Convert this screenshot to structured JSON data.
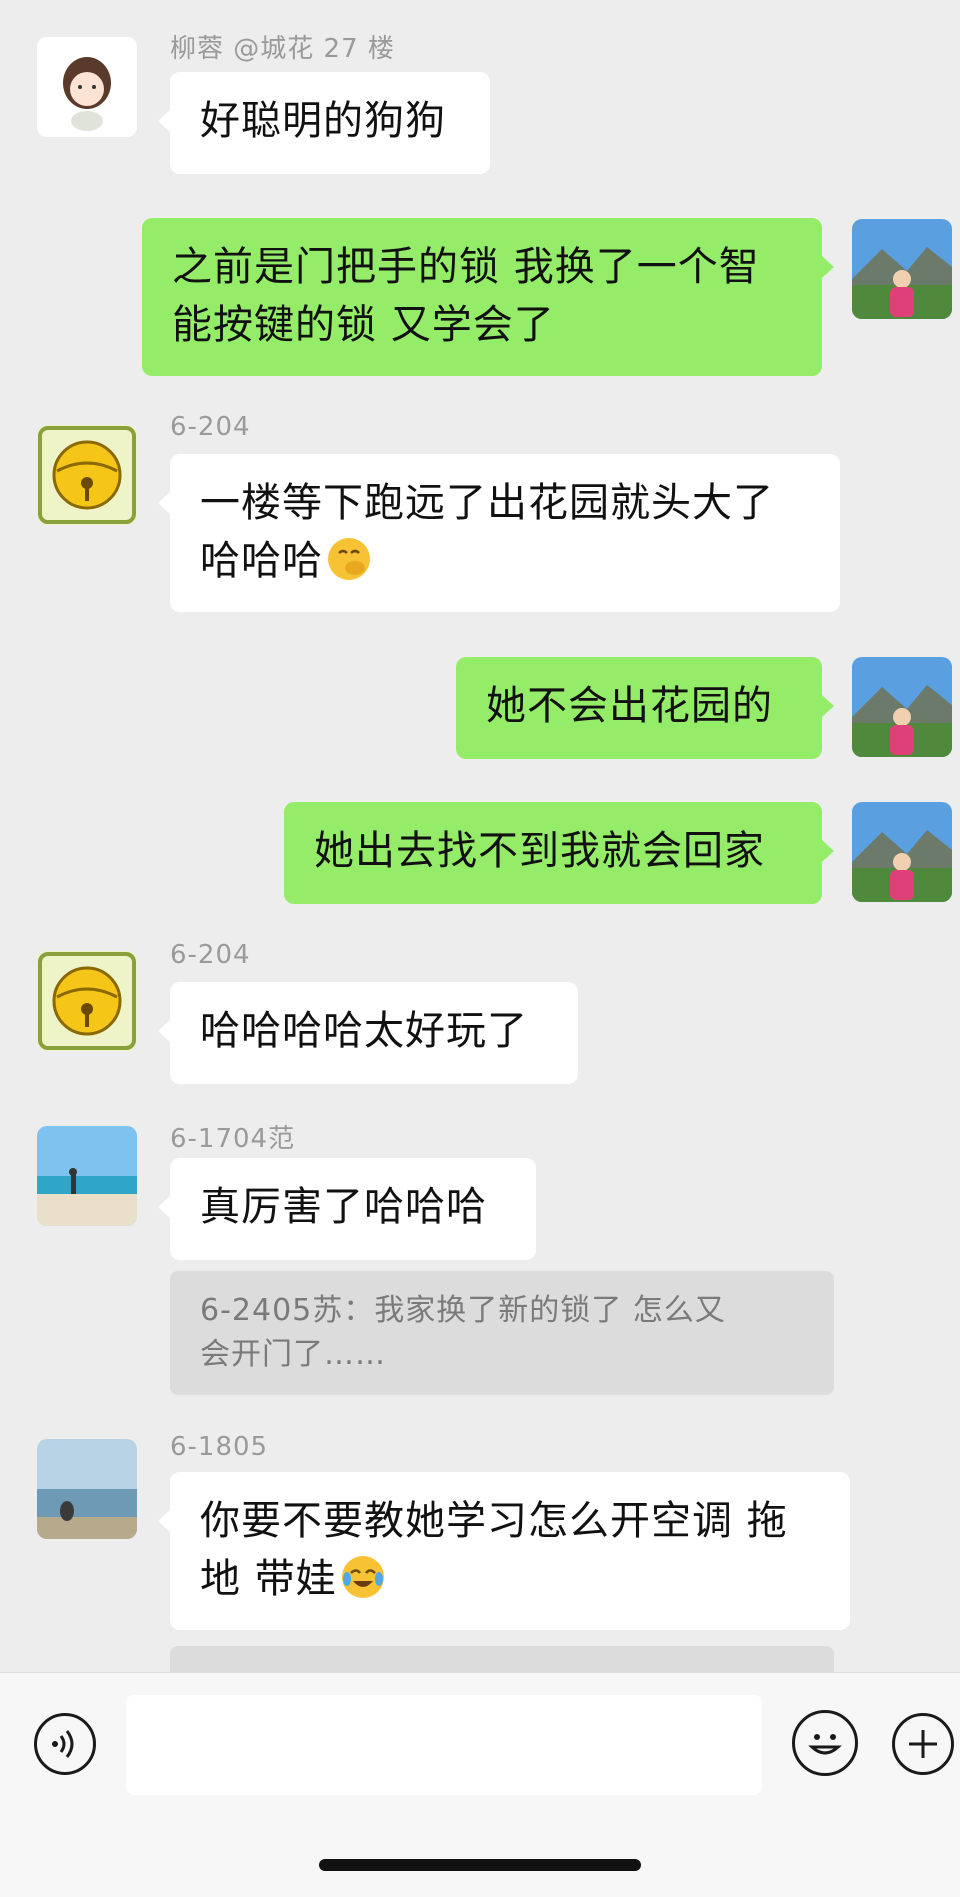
{
  "messages": [
    {
      "sender": "柳蓉 @城花 27 楼",
      "text": "好聪明的狗狗"
    },
    {
      "text_lines": [
        "之前是门把手的锁 我换了一个智",
        "能按键的锁 又学会了"
      ]
    },
    {
      "sender": "6-204",
      "text_lines": [
        "一楼等下跑远了出花园就头大了",
        "哈哈哈"
      ]
    },
    {
      "text": "她不会出花园的"
    },
    {
      "text": "她出去找不到我就会回家"
    },
    {
      "sender": "6-204",
      "text": "哈哈哈哈太好玩了"
    },
    {
      "sender": "6-1704范",
      "text": "真厉害了哈哈哈",
      "quote_lines": [
        "6-2405苏：我家换了新的锁了 怎么又",
        "会开门了……"
      ]
    },
    {
      "sender": "6-1805",
      "text_lines": [
        "你要不要教她学习怎么开空调 拖",
        "地 带娃"
      ]
    }
  ],
  "icons": {
    "voice": "voice-input-icon",
    "emoji": "emoji-icon",
    "plus": "plus-icon",
    "laugh_emoji": "hand-over-mouth-emoji",
    "cry_emoji": "tears-of-joy-emoji"
  },
  "colors": {
    "outgoing_bubble": "#95ec69",
    "incoming_bubble": "#ffffff",
    "background": "#ededed"
  }
}
